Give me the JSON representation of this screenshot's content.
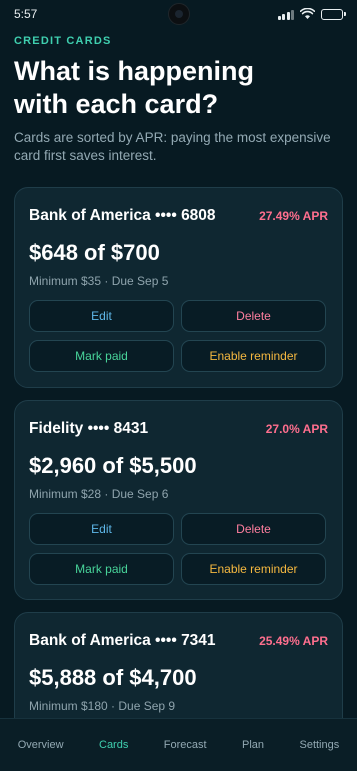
{
  "status": {
    "time": "5:57"
  },
  "header": {
    "eyebrow": "CREDIT CARDS",
    "title": "What is happening with each card?",
    "subtitle": "Cards are sorted by APR: paying the most expensive card first saves interest."
  },
  "cards": [
    {
      "name": "Bank of America •••• 6808",
      "apr": "27.49% APR",
      "balance": "$648 of $700",
      "meta": "Minimum $35 · Due Sep 5",
      "buttons": {
        "edit": "Edit",
        "delete": "Delete",
        "mark_paid": "Mark paid",
        "reminder": "Enable reminder"
      }
    },
    {
      "name": "Fidelity •••• 8431",
      "apr": "27.0% APR",
      "balance": "$2,960 of $5,500",
      "meta": "Minimum $28 · Due Sep 6",
      "buttons": {
        "edit": "Edit",
        "delete": "Delete",
        "mark_paid": "Mark paid",
        "reminder": "Enable reminder"
      }
    },
    {
      "name": "Bank of America •••• 7341",
      "apr": "25.49% APR",
      "balance": "$5,888 of $4,700",
      "meta": "Minimum $180 · Due Sep 9"
    }
  ],
  "nav": {
    "items": [
      "Overview",
      "Cards",
      "Forecast",
      "Plan",
      "Settings"
    ],
    "active": "Cards"
  },
  "colors": {
    "accent": "#3fcfaf",
    "apr": "#ff6f8e",
    "edit": "#5fb8ea",
    "delete": "#ff7f9f",
    "mark_paid": "#48d49a",
    "reminder": "#f5b840"
  }
}
